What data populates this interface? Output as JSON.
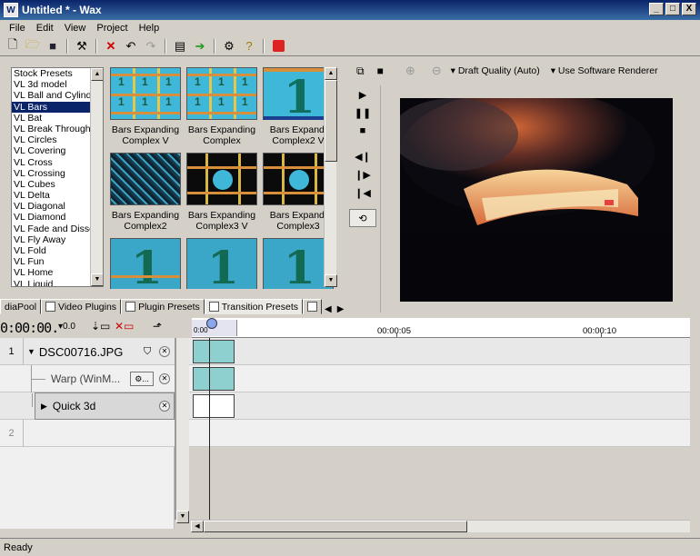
{
  "window": {
    "title": "Untitled * - Wax",
    "min": "_",
    "max": "□",
    "close": "X"
  },
  "menu": [
    "File",
    "Edit",
    "View",
    "Project",
    "Help"
  ],
  "presets": {
    "items": [
      "Stock Presets",
      "VL 3d model",
      "VL Ball and Cylinder",
      "VL Bars",
      "VL Bat",
      "VL Break Through",
      "VL Circles",
      "VL Covering",
      "VL Cross",
      "VL Crossing",
      "VL Cubes",
      "VL Delta",
      "VL Diagonal",
      "VL Diamond",
      "VL Fade and Dissolve",
      "VL Fly Away",
      "VL Fold",
      "VL Fun",
      "VL Home",
      "VL Liquid"
    ],
    "selected_index": 3
  },
  "thumbs": [
    {
      "line1": "Bars Expanding",
      "line2": "Complex V"
    },
    {
      "line1": "Bars Expanding",
      "line2": "Complex"
    },
    {
      "line1": "Bars Expandi",
      "line2": "Complex2 V"
    },
    {
      "line1": "Bars Expanding",
      "line2": "Complex2"
    },
    {
      "line1": "Bars Expanding",
      "line2": "Complex3 V"
    },
    {
      "line1": "Bars Expandi",
      "line2": "Complex3"
    }
  ],
  "tabs": [
    "diaPool",
    "Video Plugins",
    "Plugin Presets",
    "Transition Presets"
  ],
  "preview_toolbar": {
    "quality": "Draft Quality (Auto)",
    "renderer": "Use Software Renderer"
  },
  "timeline": {
    "timecode": "0:00:00.",
    "speed": "0.0",
    "ruler": [
      "00:00:05",
      "00:00:10"
    ],
    "ruler_start": "0:00",
    "tracks": [
      {
        "number": "1",
        "name": "DSC00716.JPG"
      },
      {
        "name": "Warp (WinM..."
      },
      {
        "name": "Quick 3d"
      },
      {
        "number": "2"
      }
    ]
  },
  "status": "Ready"
}
